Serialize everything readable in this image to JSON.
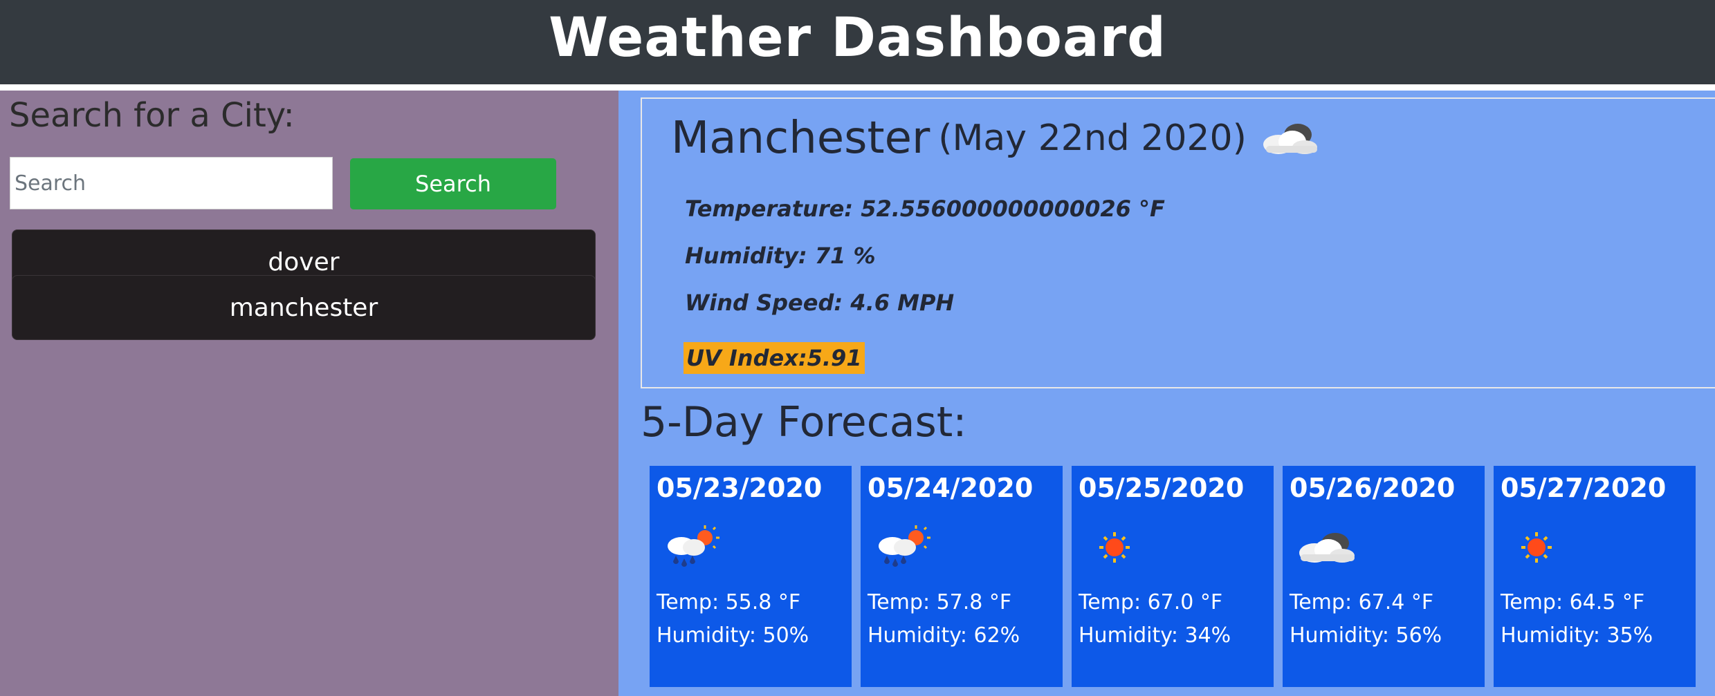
{
  "header": {
    "title": "Weather Dashboard"
  },
  "sidebar": {
    "heading": "Search for a City:",
    "search_placeholder": "Search",
    "search_value": "",
    "search_button": "Search",
    "history": [
      "dover",
      "manchester"
    ]
  },
  "current": {
    "city": "Manchester",
    "date": "(May 22nd 2020)",
    "icon": "cloud-icon",
    "temperature": "Temperature: 52.556000000000026 °F",
    "humidity": "Humidity: 71 %",
    "wind": "Wind Speed: 4.6 MPH",
    "uv": "UV Index:5.91"
  },
  "forecast": {
    "title": "5-Day Forecast:",
    "days": [
      {
        "date": "05/23/2020",
        "icon": "rain-sun-icon",
        "temp": "Temp: 55.8 °F",
        "humidity": "Humidity: 50%"
      },
      {
        "date": "05/24/2020",
        "icon": "rain-sun-icon",
        "temp": "Temp: 57.8 °F",
        "humidity": "Humidity: 62%"
      },
      {
        "date": "05/25/2020",
        "icon": "sun-icon",
        "temp": "Temp: 67.0 °F",
        "humidity": "Humidity: 34%"
      },
      {
        "date": "05/26/2020",
        "icon": "cloud-icon",
        "temp": "Temp: 67.4 °F",
        "humidity": "Humidity: 56%"
      },
      {
        "date": "05/27/2020",
        "icon": "sun-icon",
        "temp": "Temp: 64.5 °F",
        "humidity": "Humidity: 35%"
      }
    ]
  },
  "colors": {
    "header_bg": "#343a40",
    "sidebar_bg": "#8e7896",
    "main_bg": "#77a3f3",
    "card_bg": "#0d59e8",
    "search_button": "#28a745",
    "history_button": "#221e20",
    "uv_badge": "#f7a818"
  }
}
